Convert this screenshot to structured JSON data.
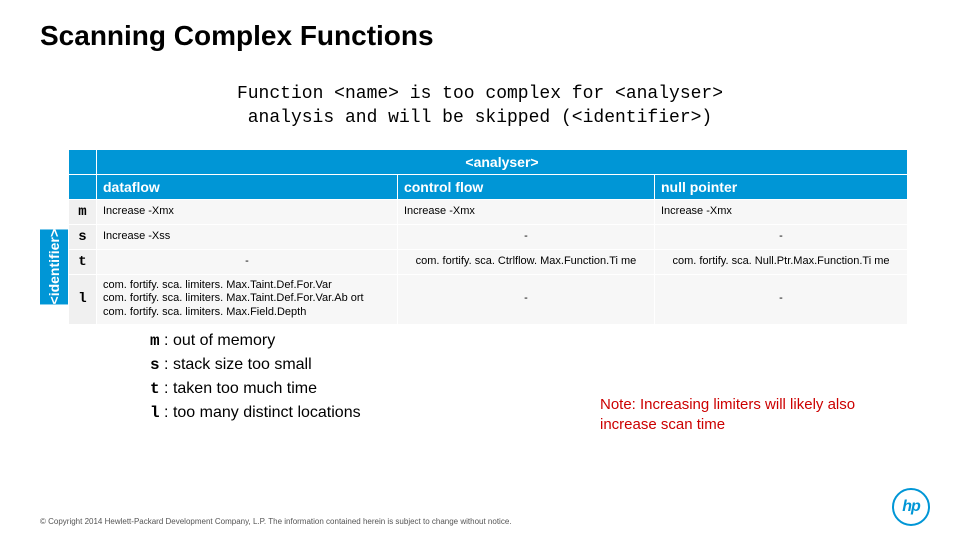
{
  "title": "Scanning Complex Functions",
  "message_l1": "Function <name> is too complex for <analyser>",
  "message_l2": "analysis and will be skipped (<identifier>)",
  "side_label": "<identifier>",
  "table": {
    "super_header": "<analyser>",
    "cols": [
      "dataflow",
      "control flow",
      "null pointer"
    ],
    "rows": [
      {
        "id": "m",
        "cells": [
          "Increase -Xmx",
          "Increase -Xmx",
          "Increase -Xmx"
        ]
      },
      {
        "id": "s",
        "cells": [
          "Increase -Xss",
          "-",
          "-"
        ]
      },
      {
        "id": "t",
        "cells": [
          "-",
          "com. fortify. sca. Ctrlflow. Max.Function.Ti me",
          "com. fortify. sca. Null.Ptr.Max.Function.Ti me"
        ]
      },
      {
        "id": "l",
        "cells": [
          "com. fortify. sca. limiters. Max.Taint.Def.For.Var\ncom. fortify. sca. limiters. Max.Taint.Def.For.Var.Ab ort\ncom. fortify. sca. limiters. Max.Field.Depth",
          "-",
          "-"
        ]
      }
    ]
  },
  "legend": [
    {
      "code": "m",
      "text": " : out of memory"
    },
    {
      "code": "s",
      "text": " : stack size too small"
    },
    {
      "code": "t",
      "text": " : taken too much time"
    },
    {
      "code": "l",
      "text": " : too many distinct locations"
    }
  ],
  "note": "Note: Increasing limiters will likely also increase scan time",
  "footer": "© Copyright 2014 Hewlett-Packard Development Company, L.P.  The information contained herein is subject to change without notice.",
  "logo_text": "hp"
}
